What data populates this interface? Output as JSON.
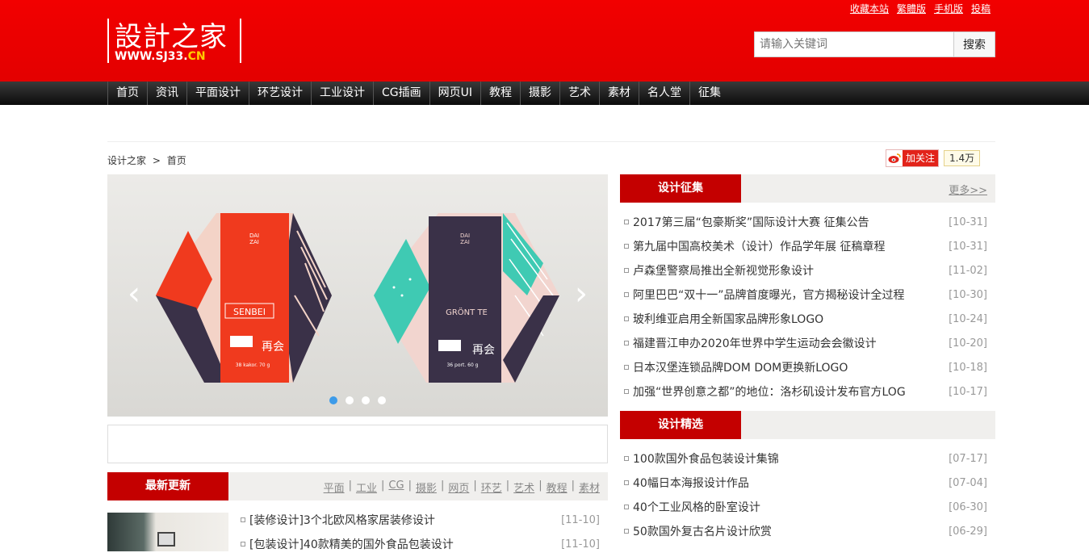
{
  "toplinks": [
    "收藏本站",
    "繁體版",
    "手机版",
    "投稿"
  ],
  "logo": {
    "text": "設計之家",
    "url_main": "WWW.SJ33.",
    "url_tld": "CN"
  },
  "search": {
    "placeholder": "请输入关键词",
    "button": "搜索"
  },
  "nav": [
    "首页",
    "资讯",
    "平面设计",
    "环艺设计",
    "工业设计",
    "CG插画",
    "网页UI",
    "教程",
    "摄影",
    "艺术",
    "素材",
    "名人堂",
    "征集"
  ],
  "breadcrumb": {
    "home": "设计之家",
    "sep": ">",
    "current": "首页"
  },
  "weibo": {
    "follow": "加关注",
    "count": "1.4万"
  },
  "slider": {
    "products": [
      {
        "brand": "SENBEI",
        "weight": "38 kakor. 70 g",
        "tag": "再会",
        "accent": "#f03a1e"
      },
      {
        "brand": "GRÖNT TE",
        "weight": "36 port. 60 g",
        "tag": "再会",
        "accent": "#3fcab3"
      }
    ],
    "logo_text": "DAI\nZAI",
    "dots": 4,
    "active_dot": 0
  },
  "latest": {
    "title": "最新更新",
    "categories": [
      "平面",
      "工业",
      "CG",
      "摄影",
      "网页",
      "环艺",
      "艺术",
      "教程",
      "素材"
    ],
    "items": [
      {
        "title": "[装修设计]3个北欧风格家居装修设计",
        "date": "[11-10]"
      },
      {
        "title": "[包装设计]40款精美的国外食品包装设计",
        "date": "[11-10]"
      }
    ]
  },
  "zhengji": {
    "title": "设计征集",
    "more": "更多>>",
    "items": [
      {
        "title": "2017第三届“包豪斯奖”国际设计大赛 征集公告",
        "date": "[10-31]"
      },
      {
        "title": "第九届中国高校美术（设计）作品学年展 征稿章程",
        "date": "[10-31]"
      },
      {
        "title": "卢森堡警察局推出全新视觉形象设计",
        "date": "[11-02]"
      },
      {
        "title": "阿里巴巴“双十一”品牌首度曝光，官方揭秘设计全过程",
        "date": "[10-30]"
      },
      {
        "title": "玻利维亚启用全新国家品牌形象LOGO",
        "date": "[10-24]"
      },
      {
        "title": "福建晋江申办2020年世界中学生运动会会徽设计",
        "date": "[10-20]"
      },
      {
        "title": "日本汉堡连锁品牌DOM DOM更换新LOGO",
        "date": "[10-18]"
      },
      {
        "title": "加强“世界创意之都”的地位：洛杉矶设计发布官方LOG",
        "date": "[10-17]"
      }
    ]
  },
  "jingxuan": {
    "title": "设计精选",
    "items": [
      {
        "title": "100款国外食品包装设计集锦",
        "date": "[07-17]"
      },
      {
        "title": "40幅日本海报设计作品",
        "date": "[07-04]"
      },
      {
        "title": "40个工业风格的卧室设计",
        "date": "[06-30]"
      },
      {
        "title": "50款国外复古名片设计欣赏",
        "date": "[06-29]"
      }
    ]
  },
  "colors": {
    "brand_red": "#e30000",
    "tab_red": "#c40000",
    "dot_active": "#3d9be9"
  }
}
